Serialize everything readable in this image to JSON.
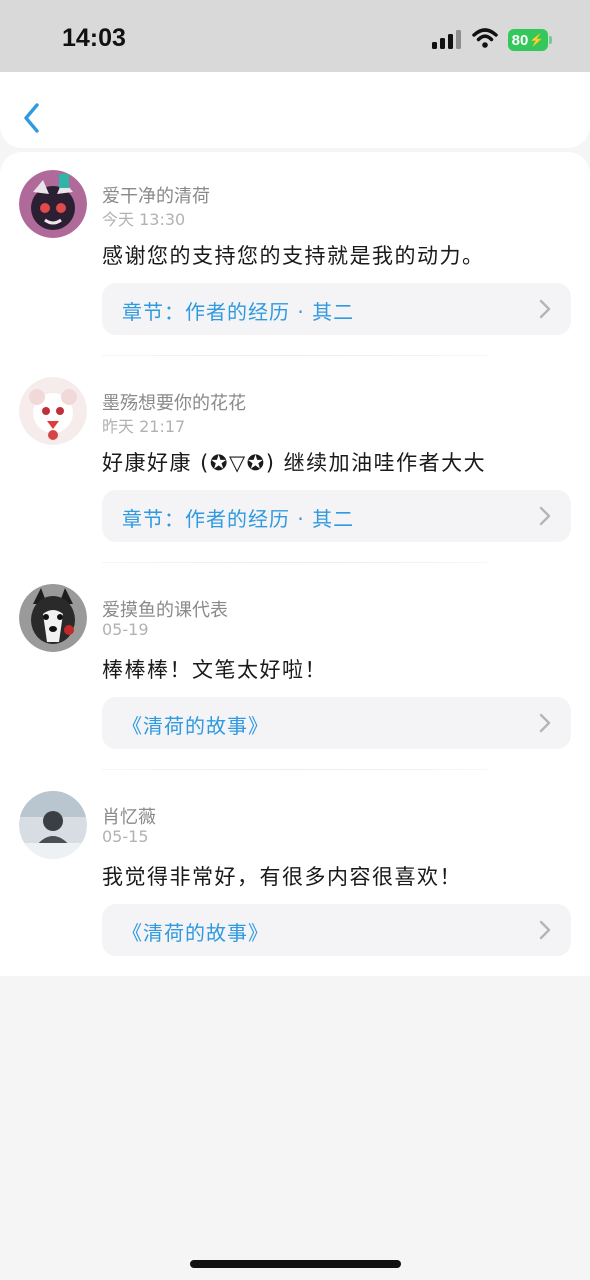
{
  "status_bar": {
    "time": "14:03",
    "battery": "80",
    "icons": [
      "signal-icon",
      "wifi-icon",
      "battery-icon"
    ]
  },
  "nav": {
    "back_icon": "chevron-left-icon"
  },
  "colors": {
    "accent": "#2f9ae0",
    "battery": "#34c759",
    "username": "#8a8a8a",
    "timestamp": "#b2b2b2"
  },
  "comments": [
    {
      "username": "爱干净的清荷",
      "time": "今天 13:30",
      "text": "感谢您的支持您的支持就是我的动力。",
      "source": "章节：作者的经历 · 其二",
      "avatar": "anime-avatar"
    },
    {
      "username": "墨殇想要你的花花",
      "time": "昨天 21:17",
      "text": "好康好康 (✪▽✪) 继续加油哇作者大大",
      "source": "章节：作者的经历 · 其二",
      "avatar": "anime-avatar"
    },
    {
      "username": "爱摸鱼的课代表",
      "time": "05-19",
      "text": "棒棒棒！文笔太好啦！",
      "source": "《清荷的故事》",
      "avatar": "husky-avatar"
    },
    {
      "username": "肖忆薇",
      "time": "05-15",
      "text": "我觉得非常好，有很多内容很喜欢！",
      "source": "《清荷的故事》",
      "avatar": "photo-avatar"
    }
  ]
}
